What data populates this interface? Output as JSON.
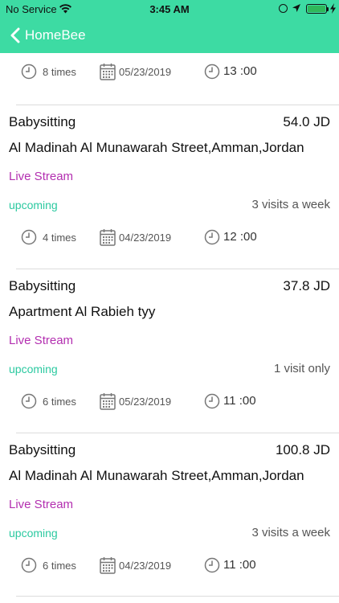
{
  "status_bar": {
    "carrier": "No Service",
    "time": "3:45 AM",
    "battery_color": "#2fb85a"
  },
  "header": {
    "title": "HomeBee",
    "back_icon": "chevron-left-icon",
    "background": "#3ddba3"
  },
  "first_partial": {
    "times": "8 times",
    "date": "05/23/2019",
    "hour": "13 :00"
  },
  "cards": [
    {
      "service": "Babysitting",
      "price": "54.0 JD",
      "address": " Al Madinah Al Munawarah Street,Amman,Jordan",
      "live": "Live Stream",
      "status": "upcoming",
      "frequency": "3 visits a week",
      "times": "4 times",
      "date": "04/23/2019",
      "hour": "12 :00"
    },
    {
      "service": "Babysitting",
      "price": "37.8 JD",
      "address": "Apartment Al Rabieh tyy",
      "live": "Live Stream",
      "status": "upcoming",
      "frequency": "1 visit only",
      "times": "6 times",
      "date": "05/23/2019",
      "hour": "11 :00"
    },
    {
      "service": "Babysitting",
      "price": "100.8 JD",
      "address": " Al Madinah Al Munawarah Street,Amman,Jordan",
      "live": "Live Stream",
      "status": "upcoming",
      "frequency": "3 visits a week",
      "times": "6 times",
      "date": "04/23/2019",
      "hour": "11 :00"
    }
  ],
  "colors": {
    "accent": "#3ddba3",
    "live_stream": "#b32fb0",
    "status": "#2bc9a0"
  }
}
